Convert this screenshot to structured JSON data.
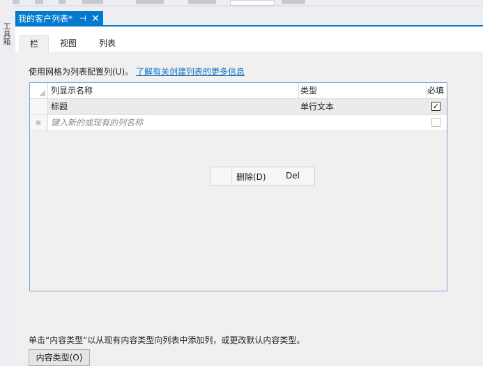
{
  "toolbox": {
    "label": "工具箱"
  },
  "document_tab": {
    "title": "我的客户列表*",
    "pin_icon": "pin-icon",
    "close_icon": "close-icon"
  },
  "inner_tabs": [
    {
      "label": "栏",
      "active": true
    },
    {
      "label": "视图",
      "active": false
    },
    {
      "label": "列表",
      "active": false
    }
  ],
  "config_text": "使用网格为列表配置列(U)。",
  "more_info_link": "了解有关创建列表的更多信息",
  "grid": {
    "headers": {
      "name": "列显示名称",
      "type": "类型",
      "required": "必填"
    },
    "rows": [
      {
        "name": "标题",
        "type": "单行文本",
        "required": true
      }
    ],
    "new_row_placeholder": "键入新的或现有的列名称"
  },
  "context_menu": {
    "items": [
      {
        "label": "删除(D)",
        "shortcut": "Del"
      }
    ]
  },
  "bottom_text": "单击“内容类型”以从现有内容类型向列表中添加列，或更改默认内容类型。",
  "content_type_button": "内容类型(O)",
  "colors": {
    "accent": "#007ACC",
    "link": "#0E70C0",
    "grid_border": "#7DA2CE"
  }
}
